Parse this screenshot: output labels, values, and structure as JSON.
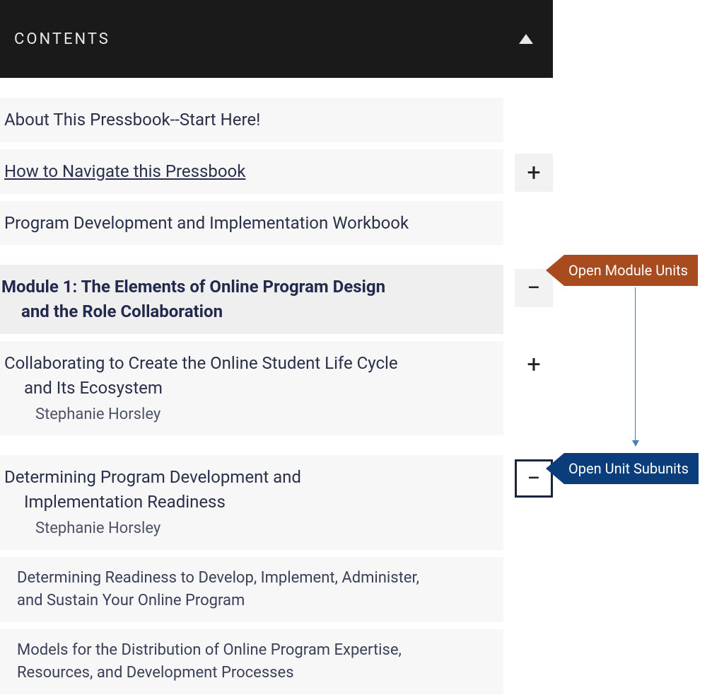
{
  "header": {
    "title": "CONTENTS"
  },
  "items": {
    "about": "About This Pressbook--Start Here!",
    "howto": "How to Navigate this Pressbook",
    "workbook": "Program Development and Implementation Workbook",
    "module1_line1": "Module 1: The Elements of Online Program Design",
    "module1_line2": "and the Role Collaboration",
    "collab_line1": "Collaborating to Create the Online Student Life Cycle",
    "collab_line2": "and Its Ecosystem",
    "collab_author": "Stephanie Horsley",
    "determine_line1": "Determining Program Development and",
    "determine_line2": "Implementation Readiness",
    "determine_author": "Stephanie Horsley",
    "sub1_line1": "Determining Readiness to Develop, Implement, Administer,",
    "sub1_line2": "and Sustain Your Online Program",
    "sub2_line1": "Models for the Distribution of Online Program Expertise,",
    "sub2_line2": "Resources, and Development Processes"
  },
  "annotations": {
    "module_units": "Open Module Units",
    "unit_subunits": "Open Unit Subunits"
  },
  "icons": {
    "plus": "+",
    "minus": "−"
  }
}
